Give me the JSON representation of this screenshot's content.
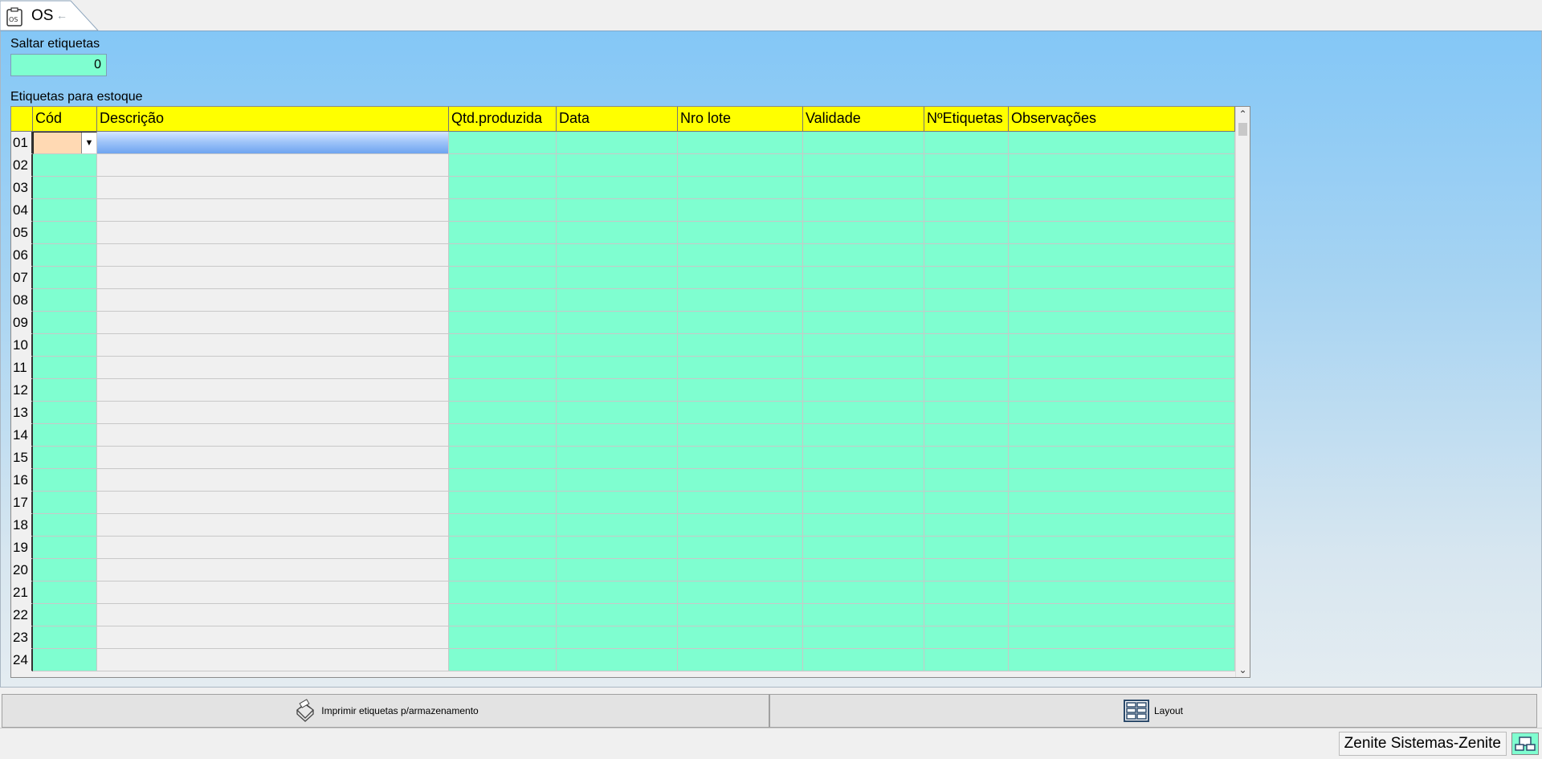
{
  "tab": {
    "title": "OS",
    "icon": "clipboard-os-icon",
    "back_icon": "arrow-left-icon"
  },
  "saltar": {
    "label": "Saltar etiquetas",
    "value": "0"
  },
  "grid": {
    "label": "Etiquetas para estoque",
    "columns": [
      {
        "key": "cod",
        "label": "Cód"
      },
      {
        "key": "descricao",
        "label": "Descrição"
      },
      {
        "key": "qtd",
        "label": "Qtd.produzida"
      },
      {
        "key": "data",
        "label": "Data"
      },
      {
        "key": "lote",
        "label": "Nro lote"
      },
      {
        "key": "validade",
        "label": "Validade"
      },
      {
        "key": "netiquetas",
        "label": "NºEtiquetas"
      },
      {
        "key": "obs",
        "label": "Observações"
      }
    ],
    "rows": [
      "01",
      "02",
      "03",
      "04",
      "05",
      "06",
      "07",
      "08",
      "09",
      "10",
      "11",
      "12",
      "13",
      "14",
      "15",
      "16",
      "17",
      "18",
      "19",
      "20",
      "21",
      "22",
      "23",
      "24"
    ]
  },
  "buttons": {
    "imprimir": {
      "label": "Imprimir etiquetas p/armazenamento",
      "icon": "printer-icon"
    },
    "layout": {
      "label": "Layout",
      "icon": "layout-grid-icon"
    }
  },
  "status": {
    "user": "Zenite Sistemas-Zenite",
    "icon": "network-status-icon"
  },
  "colors": {
    "field_green": "#7ffed0",
    "header_yellow": "#ffff00",
    "active_cell": "#ffd9b3"
  }
}
